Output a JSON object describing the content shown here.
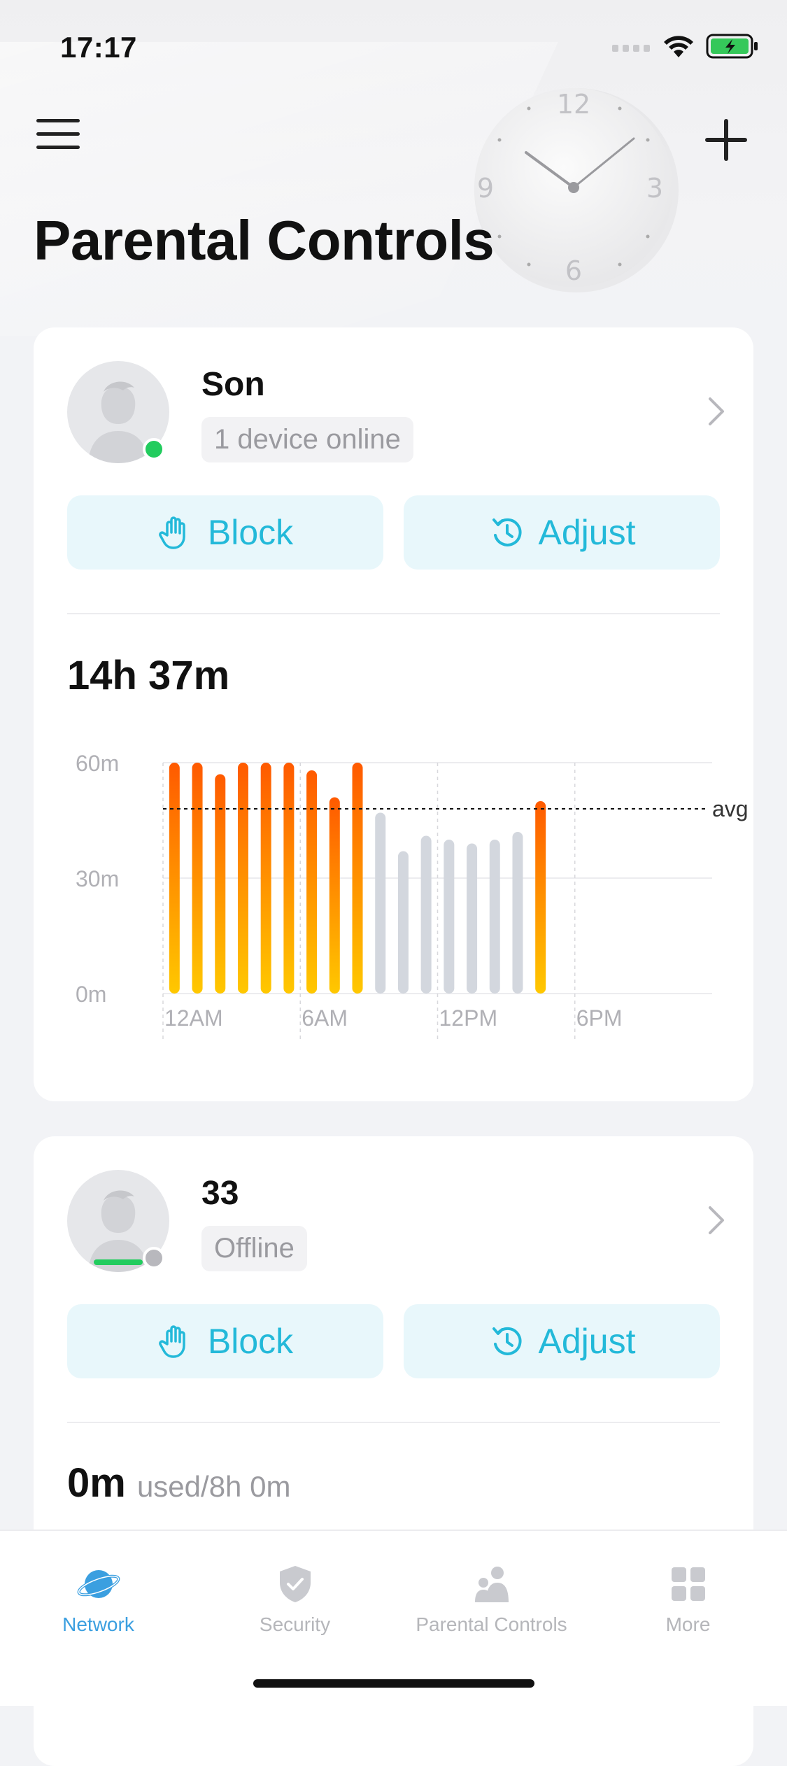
{
  "status": {
    "time": "17:17"
  },
  "header": {
    "title": "Parental Controls"
  },
  "profiles": [
    {
      "name": "Son",
      "status": "1 device online",
      "online": true,
      "block_label": "Block",
      "adjust_label": "Adjust",
      "total_time": "14h 37m"
    },
    {
      "name": "33",
      "status": "Offline",
      "online": false,
      "block_label": "Block",
      "adjust_label": "Adjust",
      "usage_value": "0m",
      "usage_limit": "used/8h 0m"
    }
  ],
  "chart_data": {
    "type": "bar",
    "x": [
      0,
      1,
      2,
      3,
      4,
      5,
      6,
      7,
      8,
      9,
      10,
      11,
      12,
      13,
      14,
      15,
      16,
      17
    ],
    "values": [
      60,
      60,
      57,
      60,
      60,
      60,
      58,
      51,
      60,
      47,
      37,
      41,
      40,
      39,
      40,
      42,
      50
    ],
    "highlight": [
      true,
      true,
      true,
      true,
      true,
      true,
      true,
      true,
      true,
      false,
      false,
      false,
      false,
      false,
      false,
      false,
      true
    ],
    "ylim": [
      0,
      60
    ],
    "yticks": [
      "0m",
      "30m",
      "60m"
    ],
    "xticks": [
      "12AM",
      "6AM",
      "12PM",
      "6PM"
    ],
    "avg": 48,
    "avg_label": "avg",
    "colors": {
      "active_top": "#ff5a00",
      "active_bottom": "#ffc800",
      "inactive": "#d3d7de"
    }
  },
  "tabbar": {
    "items": [
      {
        "label": "Network",
        "icon": "planet-icon",
        "active": true
      },
      {
        "label": "Security",
        "icon": "shield-icon",
        "active": false
      },
      {
        "label": "Parental Controls",
        "icon": "family-icon",
        "active": false
      },
      {
        "label": "More",
        "icon": "grid-icon",
        "active": false
      }
    ]
  },
  "colors": {
    "accent": "#23b9d9",
    "online": "#22cc5e",
    "offline": "#b8b8bd",
    "tab_active": "#3b9fe0"
  }
}
